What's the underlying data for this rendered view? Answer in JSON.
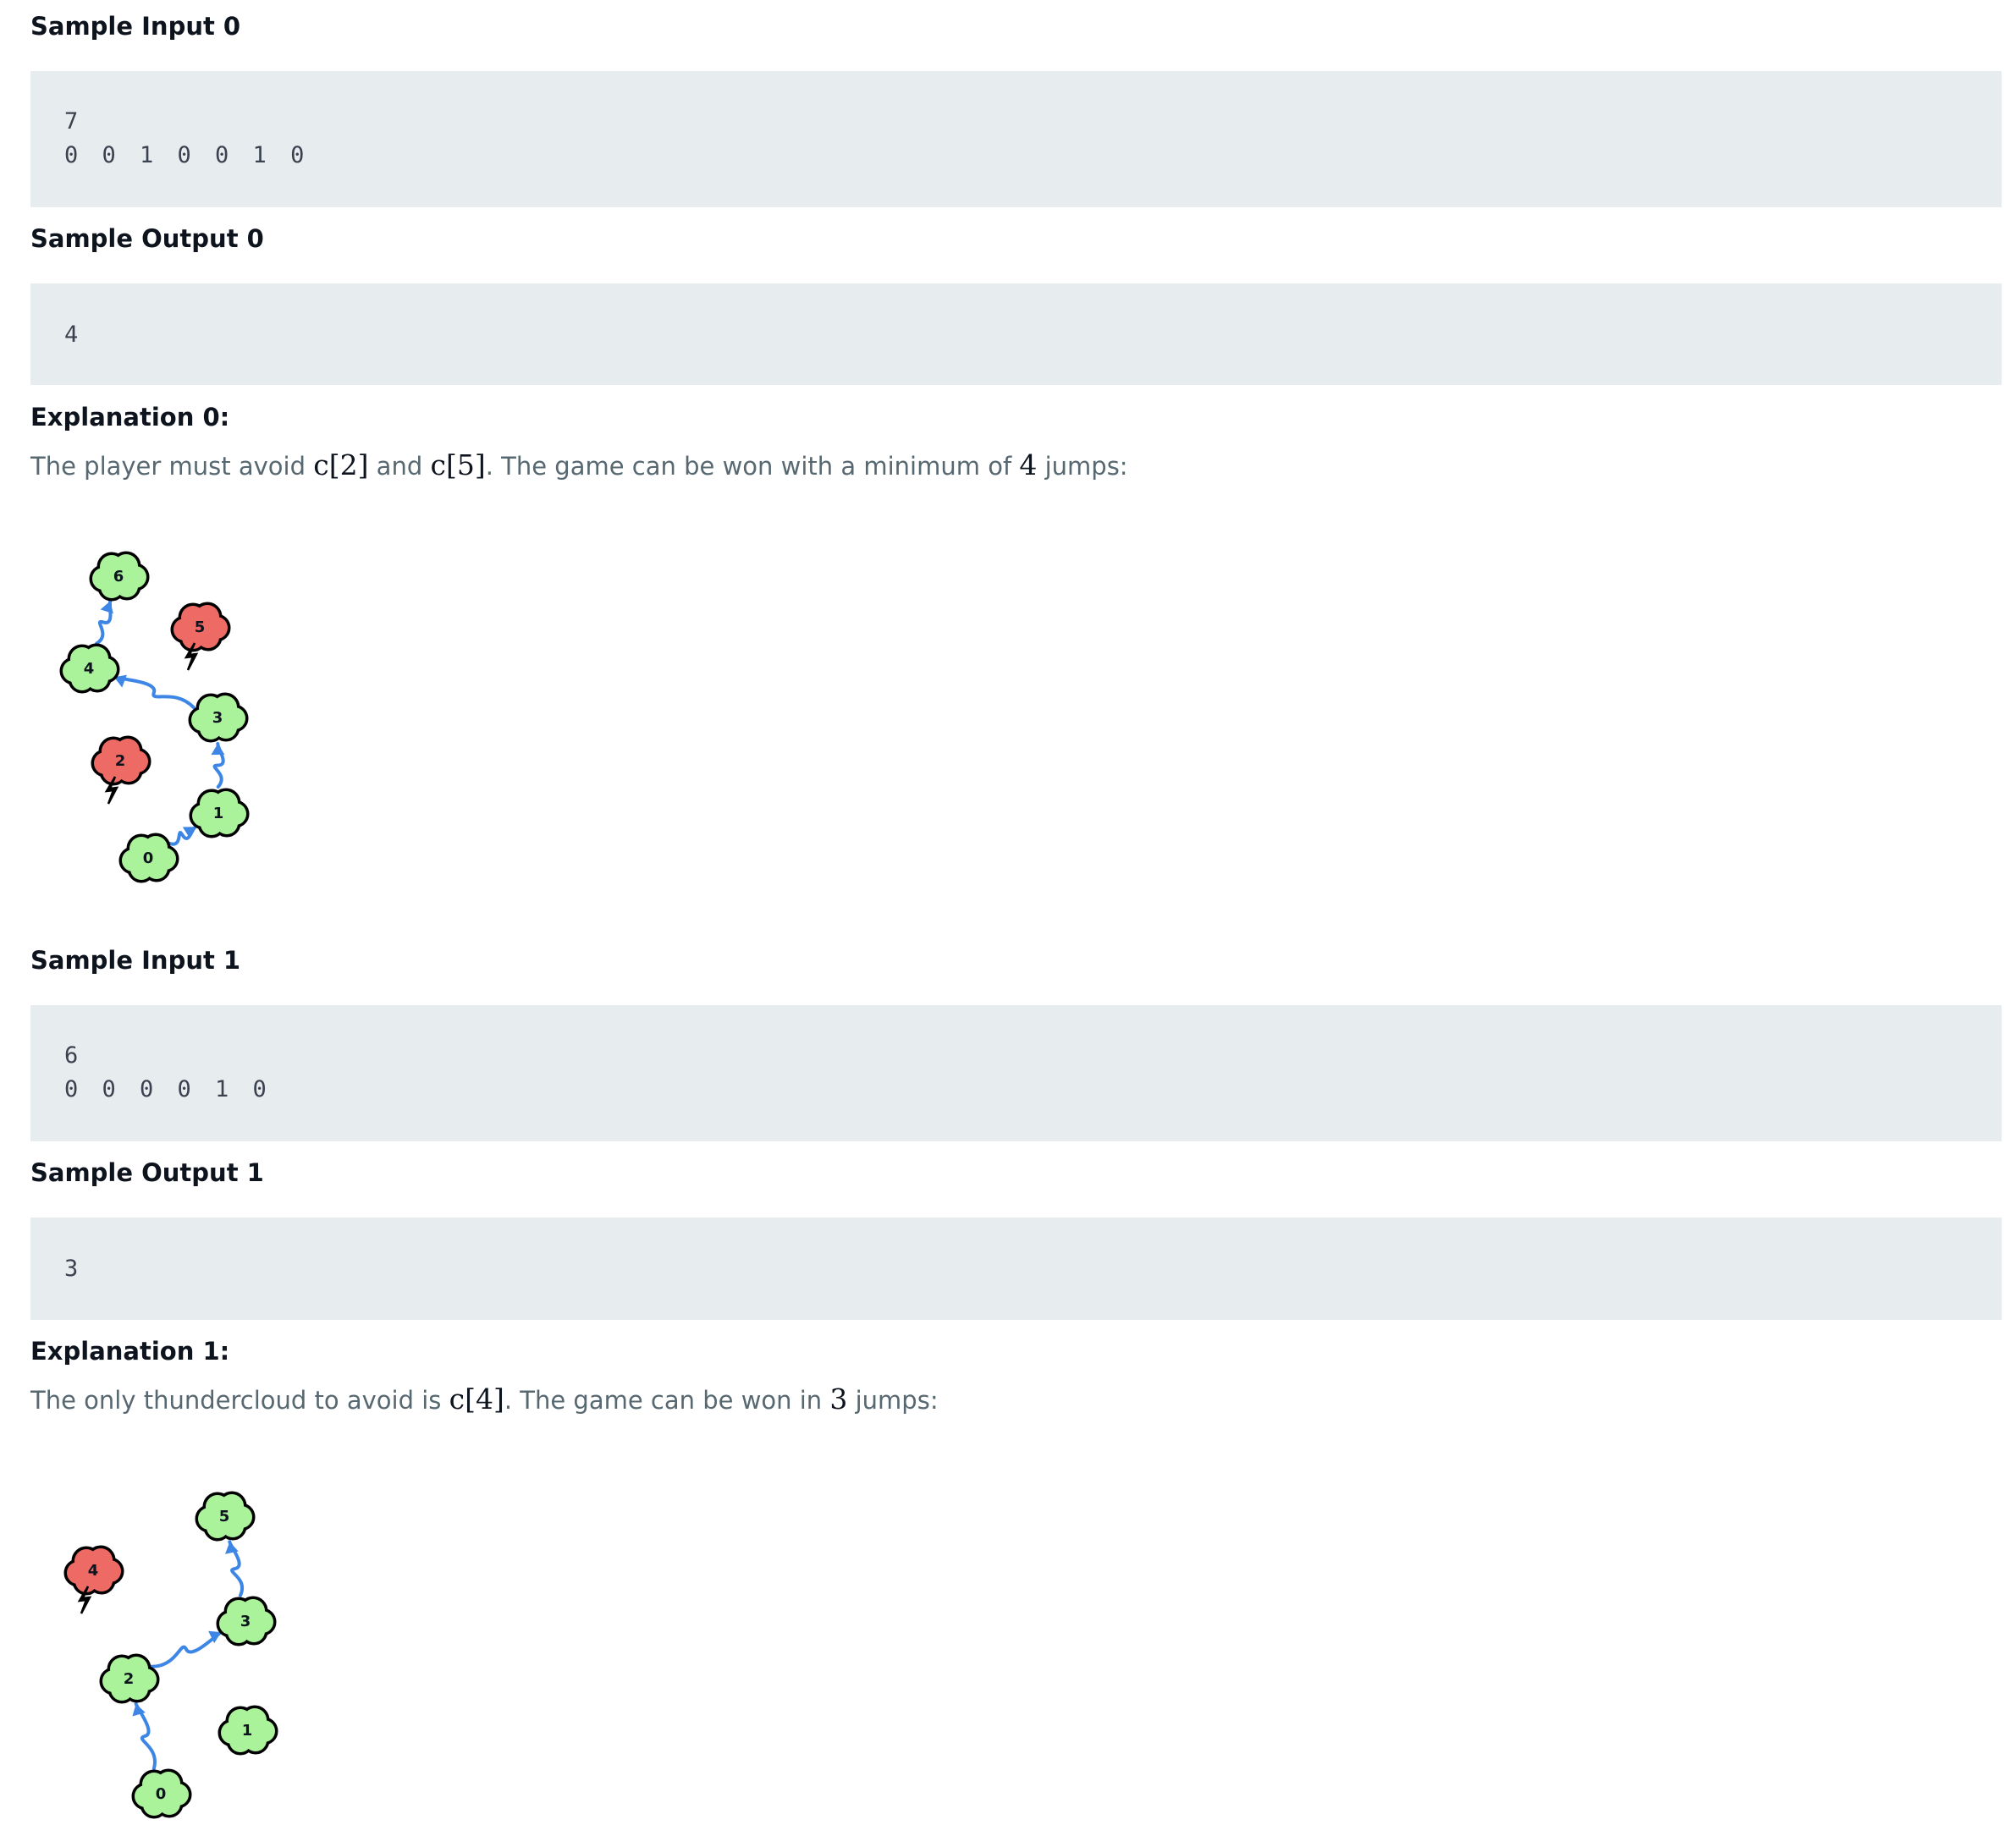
{
  "sample0": {
    "input_heading": "Sample Input 0",
    "input_lines": [
      "7",
      "0 0 1 0 0 1 0"
    ],
    "output_heading": "Sample Output 0",
    "output_lines": [
      "4"
    ],
    "explanation_heading": "Explanation 0:",
    "explanation": {
      "t1": "The player must avoid ",
      "m1": "c[2]",
      "t2": " and ",
      "m2": "c[5]",
      "t3": ". The game can be won with a minimum of ",
      "m3": "4",
      "t4": " jumps:"
    },
    "diagram": {
      "clouds": [
        {
          "label": "0",
          "type": "cumulus"
        },
        {
          "label": "1",
          "type": "cumulus"
        },
        {
          "label": "2",
          "type": "thunder"
        },
        {
          "label": "3",
          "type": "cumulus"
        },
        {
          "label": "4",
          "type": "cumulus"
        },
        {
          "label": "5",
          "type": "thunder"
        },
        {
          "label": "6",
          "type": "cumulus"
        }
      ],
      "jumps": [
        [
          0,
          1
        ],
        [
          1,
          3
        ],
        [
          3,
          4
        ],
        [
          4,
          6
        ]
      ]
    }
  },
  "sample1": {
    "input_heading": "Sample Input 1",
    "input_lines": [
      "6",
      "0 0 0 0 1 0"
    ],
    "output_heading": "Sample Output 1",
    "output_lines": [
      "3"
    ],
    "explanation_heading": "Explanation 1:",
    "explanation": {
      "t1": "The only thundercloud to avoid is ",
      "m1": "c[4]",
      "t2": ". The game can be won in ",
      "m2": "3",
      "t3": " jumps:"
    },
    "diagram": {
      "clouds": [
        {
          "label": "0",
          "type": "cumulus"
        },
        {
          "label": "1",
          "type": "cumulus"
        },
        {
          "label": "2",
          "type": "cumulus"
        },
        {
          "label": "3",
          "type": "cumulus"
        },
        {
          "label": "4",
          "type": "thunder"
        },
        {
          "label": "5",
          "type": "cumulus"
        }
      ],
      "jumps": [
        [
          0,
          2
        ],
        [
          2,
          3
        ],
        [
          3,
          5
        ]
      ]
    }
  },
  "colors": {
    "cumulus": "#aaf39b",
    "thunder": "#ee6a64",
    "arrow": "#3d86e6",
    "code_bg": "#e7ecef"
  }
}
